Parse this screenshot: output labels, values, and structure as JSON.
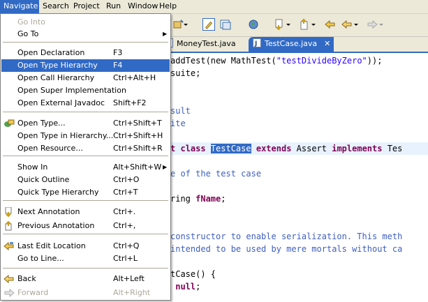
{
  "menubar": {
    "items": [
      "Navigate",
      "Search",
      "Project",
      "Run",
      "Window",
      "Help"
    ]
  },
  "editor": {
    "tabs": [
      {
        "label": "MoneyTest.java",
        "close": ""
      },
      {
        "label": "TestCase.java",
        "close": "✕"
      }
    ],
    "lines": [
      {
        "parts": [
          {
            "t": "addTest(new MathTest(",
            "c": ""
          },
          {
            "t": "\"testDivideByZero\"",
            "c": "str"
          },
          {
            "t": "));",
            "c": ""
          }
        ]
      },
      {
        "parts": [
          {
            "t": "suite;",
            "c": ""
          }
        ]
      },
      {
        "parts": []
      },
      {
        "parts": []
      },
      {
        "parts": [
          {
            "t": "sult",
            "c": "cm"
          }
        ]
      },
      {
        "parts": [
          {
            "t": "ite",
            "c": "cm"
          }
        ]
      },
      {
        "parts": []
      },
      {
        "parts": [
          {
            "t": "t ",
            "c": "kw"
          },
          {
            "t": "class ",
            "c": "kw"
          },
          {
            "t": "TestCase",
            "c": "selword"
          },
          {
            "t": " ",
            "c": ""
          },
          {
            "t": "extends",
            "c": "kw"
          },
          {
            "t": " Assert ",
            "c": ""
          },
          {
            "t": "implements",
            "c": "kw"
          },
          {
            "t": " Tes",
            "c": ""
          }
        ],
        "hl": true
      },
      {
        "parts": []
      },
      {
        "parts": [
          {
            "t": "e of the test case",
            "c": "cm"
          }
        ]
      },
      {
        "parts": []
      },
      {
        "parts": [
          {
            "t": "ring ",
            "c": ""
          },
          {
            "t": "fName",
            "c": "kw"
          },
          {
            "t": ";",
            "c": ""
          }
        ]
      },
      {
        "parts": []
      },
      {
        "parts": []
      },
      {
        "parts": [
          {
            "t": "constructor to enable serialization. This meth",
            "c": "cm"
          }
        ]
      },
      {
        "parts": [
          {
            "t": "intended to be used by mere mortals without ca",
            "c": "cm"
          }
        ]
      },
      {
        "parts": []
      },
      {
        "parts": [
          {
            "t": "tCase() {",
            "c": ""
          }
        ]
      },
      {
        "parts": [
          {
            "t": " ",
            "c": ""
          },
          {
            "t": "null",
            "c": "kw"
          },
          {
            "t": ";",
            "c": ""
          }
        ]
      }
    ]
  },
  "navigate_menu": {
    "groups": [
      [
        {
          "label": "Go Into",
          "shortcut": "",
          "disabled": true,
          "icon": "",
          "submenu": false
        },
        {
          "label": "Go To",
          "shortcut": "",
          "disabled": false,
          "icon": "",
          "submenu": true
        }
      ],
      [
        {
          "label": "Open Declaration",
          "shortcut": "F3",
          "disabled": false,
          "icon": "",
          "submenu": false
        },
        {
          "label": "Open Type Hierarchy",
          "shortcut": "F4",
          "disabled": false,
          "icon": "",
          "submenu": false,
          "hover": true
        },
        {
          "label": "Open Call Hierarchy",
          "shortcut": "Ctrl+Alt+H",
          "disabled": false,
          "icon": "",
          "submenu": false
        },
        {
          "label": "Open Super Implementation",
          "shortcut": "",
          "disabled": false,
          "icon": "",
          "submenu": false
        },
        {
          "label": "Open External Javadoc",
          "shortcut": "Shift+F2",
          "disabled": false,
          "icon": "",
          "submenu": false
        }
      ],
      [
        {
          "label": "Open Type...",
          "shortcut": "Ctrl+Shift+T",
          "disabled": false,
          "icon": "open-type-icon",
          "submenu": false
        },
        {
          "label": "Open Type in Hierarchy...",
          "shortcut": "Ctrl+Shift+H",
          "disabled": false,
          "icon": "",
          "submenu": false
        },
        {
          "label": "Open Resource...",
          "shortcut": "Ctrl+Shift+R",
          "disabled": false,
          "icon": "",
          "submenu": false
        }
      ],
      [
        {
          "label": "Show In",
          "shortcut": "Alt+Shift+W",
          "disabled": false,
          "icon": "",
          "submenu": true
        },
        {
          "label": "Quick Outline",
          "shortcut": "Ctrl+O",
          "disabled": false,
          "icon": "",
          "submenu": false
        },
        {
          "label": "Quick Type Hierarchy",
          "shortcut": "Ctrl+T",
          "disabled": false,
          "icon": "",
          "submenu": false
        }
      ],
      [
        {
          "label": "Next Annotation",
          "shortcut": "Ctrl+.",
          "disabled": false,
          "icon": "next-annotation-icon",
          "submenu": false
        },
        {
          "label": "Previous Annotation",
          "shortcut": "Ctrl+,",
          "disabled": false,
          "icon": "previous-annotation-icon",
          "submenu": false
        }
      ],
      [
        {
          "label": "Last Edit Location",
          "shortcut": "Ctrl+Q",
          "disabled": false,
          "icon": "last-edit-location-icon",
          "submenu": false
        },
        {
          "label": "Go to Line...",
          "shortcut": "Ctrl+L",
          "disabled": false,
          "icon": "",
          "submenu": false
        }
      ],
      [
        {
          "label": "Back",
          "shortcut": "Alt+Left",
          "disabled": false,
          "icon": "back-icon",
          "submenu": false
        },
        {
          "label": "Forward",
          "shortcut": "Alt+Right",
          "disabled": true,
          "icon": "forward-icon",
          "submenu": false
        }
      ]
    ]
  },
  "colors": {
    "selection": "#316ac5",
    "menubar": "#ece9d8",
    "keyword": "#7f0055",
    "comment": "#3f5fbf",
    "string": "#2a00ff"
  }
}
